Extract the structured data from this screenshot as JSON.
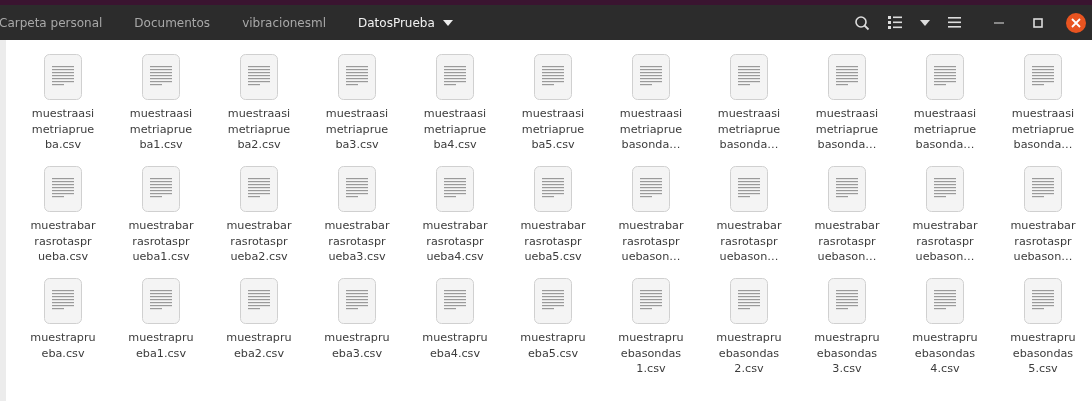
{
  "path_bar": [
    {
      "label": "Carpeta personal",
      "selected": false
    },
    {
      "label": "Documentos",
      "selected": false
    },
    {
      "label": "vibracionesml",
      "selected": false
    },
    {
      "label": "DatosPrueba",
      "selected": true
    }
  ],
  "files": [
    {
      "lines": [
        "muestraasi",
        "metriaprue",
        "ba.csv"
      ]
    },
    {
      "lines": [
        "muestraasi",
        "metriaprue",
        "ba1.csv"
      ]
    },
    {
      "lines": [
        "muestraasi",
        "metriaprue",
        "ba2.csv"
      ]
    },
    {
      "lines": [
        "muestraasi",
        "metriaprue",
        "ba3.csv"
      ]
    },
    {
      "lines": [
        "muestraasi",
        "metriaprue",
        "ba4.csv"
      ]
    },
    {
      "lines": [
        "muestraasi",
        "metriaprue",
        "ba5.csv"
      ]
    },
    {
      "lines": [
        "muestraasi",
        "metriaprue",
        "basonda…"
      ]
    },
    {
      "lines": [
        "muestraasi",
        "metriaprue",
        "basonda…"
      ]
    },
    {
      "lines": [
        "muestraasi",
        "metriaprue",
        "basonda…"
      ]
    },
    {
      "lines": [
        "muestraasi",
        "metriaprue",
        "basonda…"
      ]
    },
    {
      "lines": [
        "muestraasi",
        "metriaprue",
        "basonda…"
      ]
    },
    {
      "lines": [
        "muestrabar",
        "rasrotaspr",
        "ueba.csv"
      ]
    },
    {
      "lines": [
        "muestrabar",
        "rasrotaspr",
        "ueba1.csv"
      ]
    },
    {
      "lines": [
        "muestrabar",
        "rasrotaspr",
        "ueba2.csv"
      ]
    },
    {
      "lines": [
        "muestrabar",
        "rasrotaspr",
        "ueba3.csv"
      ]
    },
    {
      "lines": [
        "muestrabar",
        "rasrotaspr",
        "ueba4.csv"
      ]
    },
    {
      "lines": [
        "muestrabar",
        "rasrotaspr",
        "ueba5.csv"
      ]
    },
    {
      "lines": [
        "muestrabar",
        "rasrotaspr",
        "uebason…"
      ]
    },
    {
      "lines": [
        "muestrabar",
        "rasrotaspr",
        "uebason…"
      ]
    },
    {
      "lines": [
        "muestrabar",
        "rasrotaspr",
        "uebason…"
      ]
    },
    {
      "lines": [
        "muestrabar",
        "rasrotaspr",
        "uebason…"
      ]
    },
    {
      "lines": [
        "muestrabar",
        "rasrotaspr",
        "uebason…"
      ]
    },
    {
      "lines": [
        "muestrapru",
        "eba.csv"
      ]
    },
    {
      "lines": [
        "muestrapru",
        "eba1.csv"
      ]
    },
    {
      "lines": [
        "muestrapru",
        "eba2.csv"
      ]
    },
    {
      "lines": [
        "muestrapru",
        "eba3.csv"
      ]
    },
    {
      "lines": [
        "muestrapru",
        "eba4.csv"
      ]
    },
    {
      "lines": [
        "muestrapru",
        "eba5.csv"
      ]
    },
    {
      "lines": [
        "muestrapru",
        "ebasondas",
        "1.csv"
      ]
    },
    {
      "lines": [
        "muestrapru",
        "ebasondas",
        "2.csv"
      ]
    },
    {
      "lines": [
        "muestrapru",
        "ebasondas",
        "3.csv"
      ]
    },
    {
      "lines": [
        "muestrapru",
        "ebasondas",
        "4.csv"
      ]
    },
    {
      "lines": [
        "muestrapru",
        "ebasondas",
        "5.csv"
      ]
    }
  ]
}
